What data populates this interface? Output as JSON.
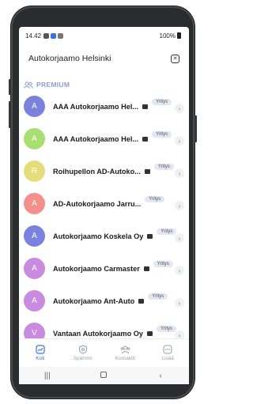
{
  "status_bar": {
    "time": "14.42",
    "battery": "100%"
  },
  "search": {
    "query": "Autokorjaamo Helsinki",
    "clear_icon": "close-icon"
  },
  "section": {
    "title": "PREMIUM",
    "icon": "group-icon"
  },
  "results": [
    {
      "initial": "A",
      "name": "AAA Autokorjaamo Hel...",
      "badge": "Yritys",
      "color": "#7b82de"
    },
    {
      "initial": "A",
      "name": "AAA Autokorjaamo Hel...",
      "badge": "Yritys",
      "color": "#a7e070"
    },
    {
      "initial": "R",
      "name": "Roihupellon AD-Autoko...",
      "badge": "Yritys",
      "color": "#e6dc7a"
    },
    {
      "initial": "A",
      "name": "AD-Autokorjaamo Jarru...",
      "badge": "Yritys",
      "color": "#f4908c"
    },
    {
      "initial": "A",
      "name": "Autokorjaamo Koskela Oy",
      "badge": "Yritys",
      "color": "#7b82de"
    },
    {
      "initial": "A",
      "name": "Autokorjaamo Carmaster",
      "badge": "Yritys",
      "color": "#c98be0"
    },
    {
      "initial": "A",
      "name": "Autokorjaamo Ant-Auto",
      "badge": "Yritys",
      "color": "#c98be0"
    },
    {
      "initial": "V",
      "name": "Vantaan Autokorjaamo Oy",
      "badge": "Yritys",
      "color": "#c98be0"
    }
  ],
  "bottom_nav": [
    {
      "label": "Koti",
      "icon": "home-chart-icon",
      "active": true
    },
    {
      "label": "Spämmi",
      "icon": "shield-icon",
      "active": false
    },
    {
      "label": "Kontaktit",
      "icon": "contacts-icon",
      "active": false
    },
    {
      "label": "Lisää",
      "icon": "more-icon",
      "active": false
    }
  ],
  "colors": {
    "accent": "#3b74d8",
    "section": "#8e9bd6",
    "badge_bg": "#e3e7ef"
  }
}
